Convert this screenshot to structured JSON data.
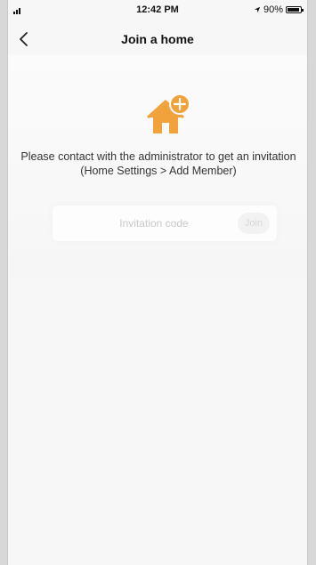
{
  "status_bar": {
    "time": "12:42 PM",
    "battery_percent": "90%",
    "battery_level": 0.9,
    "icons": [
      "signal-icon",
      "location-icon",
      "battery-icon"
    ]
  },
  "nav": {
    "title": "Join a home",
    "back_icon": "chevron-left-icon"
  },
  "main": {
    "icon": "home-add-icon",
    "instruction": "Please contact with the administrator to get an invitation (Home Settings > Add Member)",
    "code_field": {
      "placeholder": "Invitation code",
      "value": ""
    },
    "join_button_label": "Join"
  },
  "colors": {
    "accent": "#f2a23a",
    "text": "#333333",
    "placeholder": "#c9c9c9"
  }
}
